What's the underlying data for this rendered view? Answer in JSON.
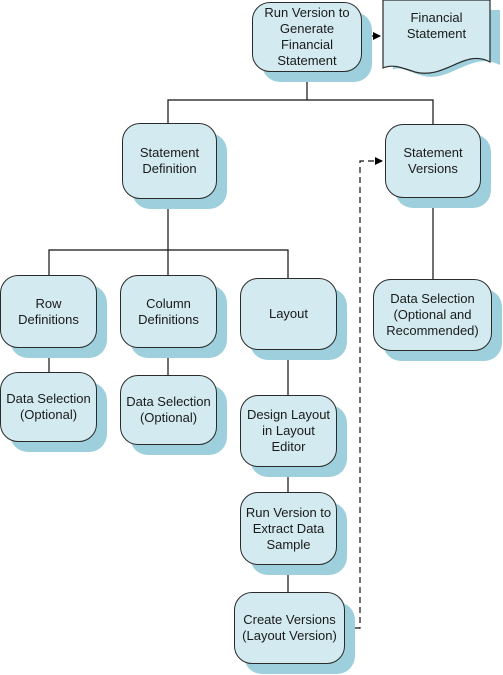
{
  "diagram": {
    "colors": {
      "box_fill": "#d3ebf0",
      "shadow": "#9dd0dc",
      "stroke": "#2a2a2a"
    },
    "nodes": {
      "run_version_generate": "Run Version to\nGenerate\nFinancial\nStatement",
      "financial_statement": "Financial\nStatement",
      "statement_definition": "Statement\nDefinition",
      "statement_versions": "Statement\nVersions",
      "row_definitions": "Row\nDefinitions",
      "column_definitions": "Column\nDefinitions",
      "layout": "Layout",
      "data_selection_row": "Data Selection\n(Optional)",
      "data_selection_column": "Data Selection\n(Optional)",
      "data_selection_versions": "Data Selection\n(Optional and\nRecommended)",
      "design_layout": "Design Layout\nin Layout\nEditor",
      "run_version_extract": "Run Version to\nExtract Data\nSample",
      "create_versions": "Create  Versions\n(Layout Version)"
    },
    "edges": [
      {
        "from": "statement_definition",
        "to": "run_version_generate",
        "style": "solid"
      },
      {
        "from": "statement_versions",
        "to": "run_version_generate",
        "style": "solid"
      },
      {
        "from": "run_version_generate",
        "to": "financial_statement",
        "style": "dashed"
      },
      {
        "from": "row_definitions",
        "to": "statement_definition",
        "style": "solid"
      },
      {
        "from": "column_definitions",
        "to": "statement_definition",
        "style": "solid"
      },
      {
        "from": "layout",
        "to": "statement_definition",
        "style": "solid"
      },
      {
        "from": "data_selection_row",
        "to": "row_definitions",
        "style": "solid"
      },
      {
        "from": "data_selection_column",
        "to": "column_definitions",
        "style": "solid"
      },
      {
        "from": "data_selection_versions",
        "to": "statement_versions",
        "style": "solid"
      },
      {
        "from": "design_layout",
        "to": "layout",
        "style": "solid"
      },
      {
        "from": "run_version_extract",
        "to": "design_layout",
        "style": "solid"
      },
      {
        "from": "create_versions",
        "to": "run_version_extract",
        "style": "solid"
      },
      {
        "from": "create_versions",
        "to": "statement_versions",
        "style": "dashed"
      }
    ]
  }
}
